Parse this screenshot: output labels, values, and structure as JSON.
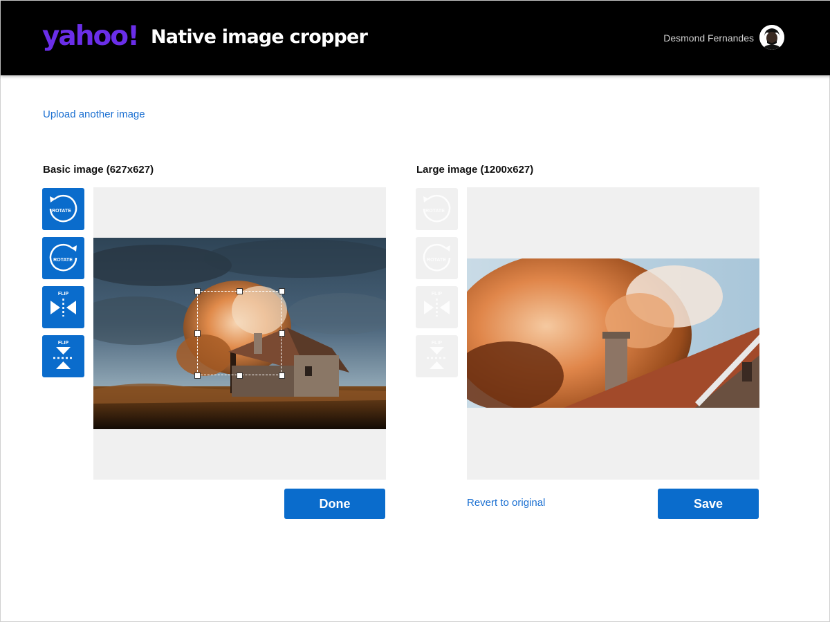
{
  "header": {
    "logo_text": "yahoo!",
    "title": "Native image cropper",
    "user_name": "Desmond Fernandes"
  },
  "actions": {
    "upload_link": "Upload another image",
    "revert_link": "Revert to original",
    "done_label": "Done",
    "save_label": "Save"
  },
  "panels": {
    "basic": {
      "title": "Basic image (627x627)",
      "tools": [
        {
          "icon": "rotate-left-icon",
          "label": "ROTATE",
          "enabled": true
        },
        {
          "icon": "rotate-right-icon",
          "label": "ROTATE",
          "enabled": true
        },
        {
          "icon": "flip-horizontal-icon",
          "label": "FLIP",
          "enabled": true
        },
        {
          "icon": "flip-vertical-icon",
          "label": "FLIP",
          "enabled": true
        }
      ]
    },
    "large": {
      "title": "Large image (1200x627)",
      "tools": [
        {
          "icon": "rotate-left-icon",
          "label": "ROTATE",
          "enabled": false
        },
        {
          "icon": "rotate-right-icon",
          "label": "ROTATE",
          "enabled": false
        },
        {
          "icon": "flip-horizontal-icon",
          "label": "FLIP",
          "enabled": false
        },
        {
          "icon": "flip-vertical-icon",
          "label": "FLIP",
          "enabled": false
        }
      ]
    }
  },
  "colors": {
    "brand_purple": "#6a2ee8",
    "accent_blue": "#0a6ccc",
    "link_blue": "#1a6fd1",
    "header_bg": "#000000",
    "canvas_bg": "#f0f0f0"
  }
}
